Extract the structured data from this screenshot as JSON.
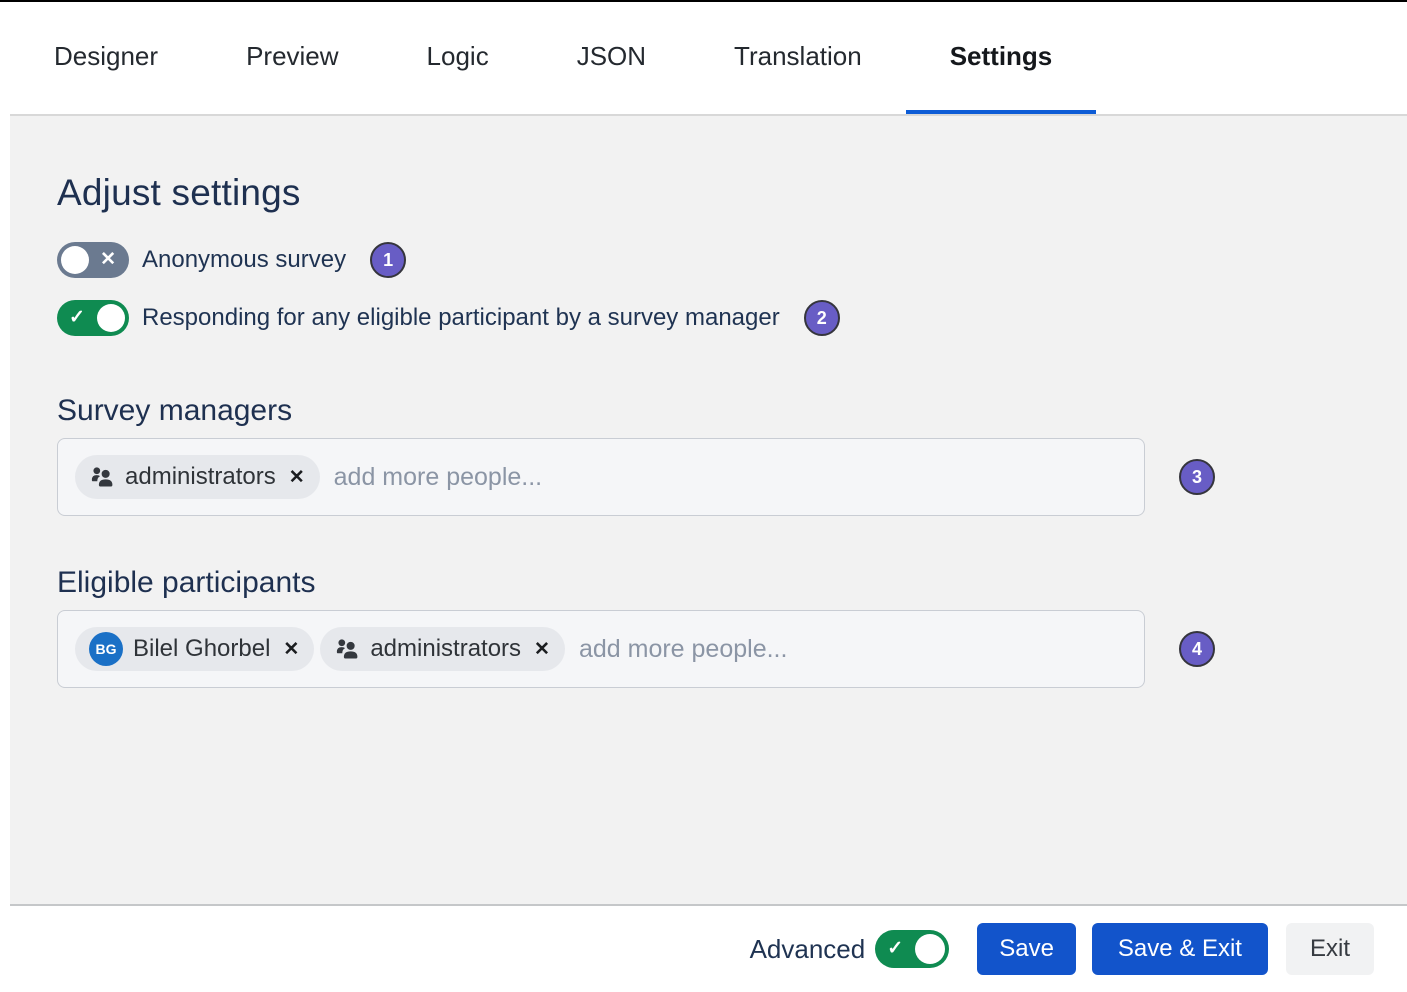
{
  "tabs": {
    "items": [
      {
        "label": "Designer",
        "active": false
      },
      {
        "label": "Preview",
        "active": false
      },
      {
        "label": "Logic",
        "active": false
      },
      {
        "label": "JSON",
        "active": false
      },
      {
        "label": "Translation",
        "active": false
      },
      {
        "label": "Settings",
        "active": true
      }
    ]
  },
  "panel": {
    "title": "Adjust settings",
    "toggles": [
      {
        "label": "Anonymous survey",
        "state": "off",
        "badge": "1"
      },
      {
        "label": "Responding for any eligible participant by a survey manager",
        "state": "on",
        "badge": "2"
      }
    ],
    "fields": [
      {
        "title": "Survey managers",
        "badge": "3",
        "placeholder": "add more people...",
        "chips": [
          {
            "type": "group",
            "icon": "people-icon",
            "label": "administrators"
          }
        ]
      },
      {
        "title": "Eligible participants",
        "badge": "4",
        "placeholder": "add more people...",
        "chips": [
          {
            "type": "person",
            "avatar_initials": "BG",
            "label": "Bilel Ghorbel"
          },
          {
            "type": "group",
            "icon": "people-icon",
            "label": "administrators"
          }
        ]
      }
    ]
  },
  "footer": {
    "advanced_label": "Advanced",
    "advanced_state": "on",
    "save_label": "Save",
    "save_exit_label": "Save & Exit",
    "exit_label": "Exit"
  },
  "icons": {
    "check_glyph": "✓",
    "x_glyph": "✕",
    "chip_close_glyph": "✕"
  },
  "colors": {
    "tab_underline_blue": "#0d5cd6",
    "primary_button_blue": "#1254cb",
    "toggle_on_green": "#0f8b51",
    "toggle_off_gray": "#6b7a90",
    "badge_purple": "#685dc5",
    "heading_navy": "#1e3050",
    "avatar_blue": "#1a70c6",
    "panel_gray": "#f2f2f2"
  }
}
